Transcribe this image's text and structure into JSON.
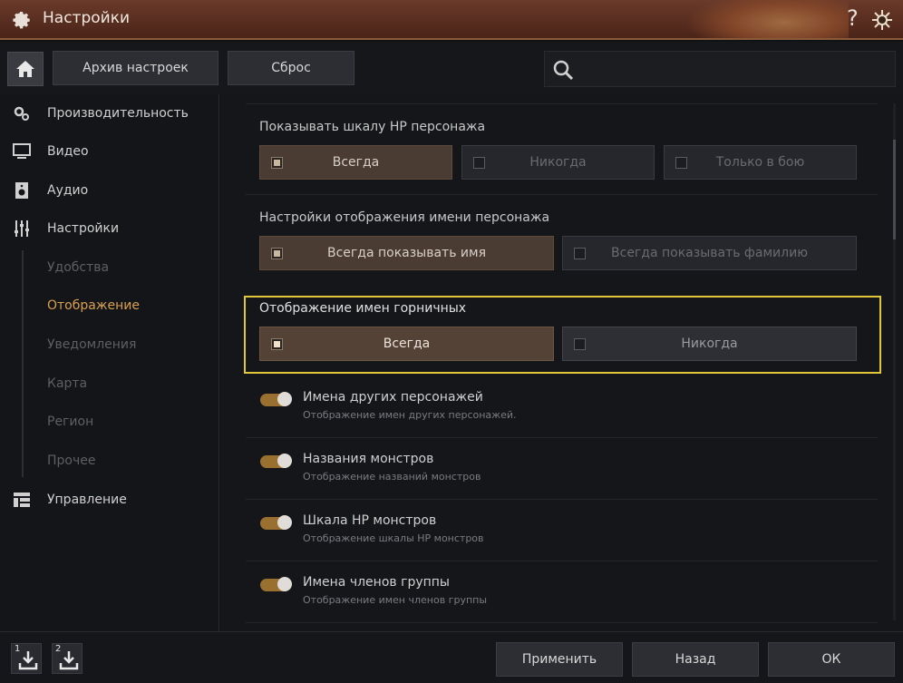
{
  "window": {
    "title": "Настройки",
    "help_label": "?",
    "icons": {
      "settings": "gear-icon",
      "help": "help-icon",
      "close": "close-icon"
    }
  },
  "toolbar": {
    "archive_label": "Архив настроек",
    "reset_label": "Сброс",
    "search_placeholder": "",
    "icons": {
      "home": "home-icon",
      "search": "search-icon"
    }
  },
  "sidebar": {
    "items": [
      {
        "label": "Производительность",
        "icon": "gears-icon"
      },
      {
        "label": "Видео",
        "icon": "monitor-icon"
      },
      {
        "label": "Аудио",
        "icon": "speaker-icon"
      },
      {
        "label": "Настройки",
        "icon": "sliders-icon"
      },
      {
        "label": "Удобства"
      },
      {
        "label": "Отображение",
        "active": true
      },
      {
        "label": "Уведомления"
      },
      {
        "label": "Карта"
      },
      {
        "label": "Регион"
      },
      {
        "label": "Прочее"
      },
      {
        "label": "Управление",
        "icon": "layout-icon"
      }
    ]
  },
  "main": {
    "sections": [
      {
        "title": "Показывать шкалу HP персонажа",
        "options": [
          {
            "label": "Всегда",
            "selected": true
          },
          {
            "label": "Никогда",
            "selected": false
          },
          {
            "label": "Только в бою",
            "selected": false
          }
        ]
      },
      {
        "title": "Настройки отображения имени персонажа",
        "options": [
          {
            "label": "Всегда показывать имя",
            "selected": true
          },
          {
            "label": "Всегда показывать фамилию",
            "selected": false
          }
        ]
      },
      {
        "title": "Отображение имен горничных",
        "highlighted": true,
        "options": [
          {
            "label": "Всегда",
            "selected": true
          },
          {
            "label": "Никогда",
            "selected": false
          }
        ]
      }
    ],
    "toggles": [
      {
        "label": "Имена других персонажей",
        "desc": "Отображение имен других персонажей.",
        "on": true
      },
      {
        "label": "Названия монстров",
        "desc": "Отображение названий монстров",
        "on": true
      },
      {
        "label": "Шкала HP монстров",
        "desc": "Отображение шкалы HP монстров",
        "on": true
      },
      {
        "label": "Имена членов группы",
        "desc": "Отображение имен членов группы",
        "on": true
      }
    ]
  },
  "footer": {
    "slot1_label": "1",
    "slot2_label": "2",
    "apply_label": "Применить",
    "back_label": "Назад",
    "ok_label": "ОК"
  },
  "colors": {
    "accent": "#d8a050",
    "highlight": "#e2c63a",
    "toggle_on": "#9a7030",
    "titlebar": "#5a2e20"
  }
}
